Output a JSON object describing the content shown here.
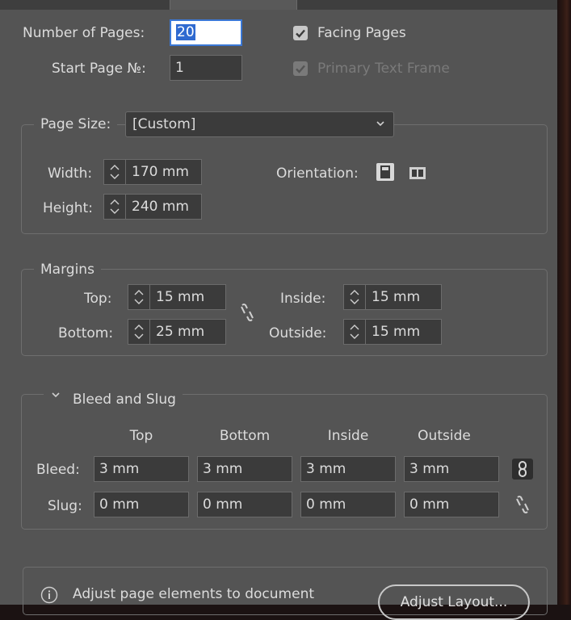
{
  "pages": {
    "number_label": "Number of Pages:",
    "number_value": "20",
    "start_label": "Start Page №:",
    "start_value": "1",
    "facing_label": "Facing Pages",
    "facing_checked": true,
    "primary_label": "Primary Text Frame",
    "primary_checked": true,
    "primary_disabled": true
  },
  "page_size": {
    "label": "Page Size:",
    "selected": "[Custom]",
    "width_label": "Width:",
    "width_value": "170 mm",
    "height_label": "Height:",
    "height_value": "240 mm",
    "orientation_label": "Orientation:",
    "orientation_selected": "portrait",
    "icons": [
      "portrait-orientation-icon",
      "landscape-orientation-icon"
    ]
  },
  "margins": {
    "label": "Margins",
    "top_label": "Top:",
    "top_value": "15 mm",
    "bottom_label": "Bottom:",
    "bottom_value": "25 mm",
    "inside_label": "Inside:",
    "inside_value": "15 mm",
    "outside_label": "Outside:",
    "outside_value": "15 mm",
    "link_state": "unlinked"
  },
  "bleed_slug": {
    "label": "Bleed and Slug",
    "expanded": true,
    "columns": [
      "Top",
      "Bottom",
      "Inside",
      "Outside"
    ],
    "bleed_label": "Bleed:",
    "bleed_values": [
      "3 mm",
      "3 mm",
      "3 mm",
      "3 mm"
    ],
    "bleed_link_state": "linked",
    "slug_label": "Slug:",
    "slug_values": [
      "0 mm",
      "0 mm",
      "0 mm",
      "0 mm"
    ],
    "slug_link_state": "unlinked"
  },
  "adjust": {
    "info_text": "Adjust page elements to document",
    "button_label": "Adjust Layout..."
  },
  "colors": {
    "panel_bg": "#545454",
    "field_bg": "#3b3b3b",
    "focus_border": "#3a78d6",
    "selection": "#2f6ad0"
  }
}
